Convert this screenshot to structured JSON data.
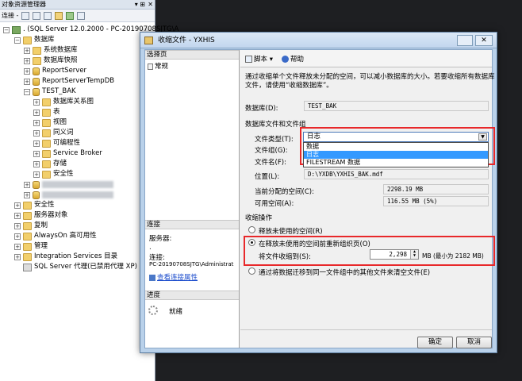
{
  "object_explorer": {
    "title": "对象资源管理器",
    "connect_label": "连接 -",
    "tree": [
      {
        "label": ". (SQL Server 12.0.2000 - PC-20190708SJTG\\A",
        "icon": "server-icon",
        "expander": "−"
      },
      {
        "label": "数据库",
        "icon": "folder-icon",
        "expander": "−"
      },
      {
        "label": "系统数据库",
        "icon": "folder-icon",
        "expander": "+"
      },
      {
        "label": "数据库快照",
        "icon": "folder-icon",
        "expander": "+"
      },
      {
        "label": "ReportServer",
        "icon": "database-icon",
        "expander": "+"
      },
      {
        "label": "ReportServerTempDB",
        "icon": "database-icon",
        "expander": "+"
      },
      {
        "label": "TEST_BAK",
        "icon": "database-icon",
        "expander": "−"
      },
      {
        "label": "数据库关系图",
        "icon": "folder-icon",
        "expander": "+"
      },
      {
        "label": "表",
        "icon": "folder-icon",
        "expander": "+"
      },
      {
        "label": "视图",
        "icon": "folder-icon",
        "expander": "+"
      },
      {
        "label": "同义词",
        "icon": "folder-icon",
        "expander": "+"
      },
      {
        "label": "可编程性",
        "icon": "folder-icon",
        "expander": "+"
      },
      {
        "label": "Service Broker",
        "icon": "folder-icon",
        "expander": "+"
      },
      {
        "label": "存储",
        "icon": "folder-icon",
        "expander": "+"
      },
      {
        "label": "安全性",
        "icon": "folder-icon",
        "expander": "+"
      },
      {
        "label": "",
        "icon": "database-icon",
        "expander": "+"
      },
      {
        "label": "",
        "icon": "database-icon",
        "expander": "+"
      },
      {
        "label": "安全性",
        "icon": "folder-icon",
        "expander": "+"
      },
      {
        "label": "服务器对象",
        "icon": "folder-icon",
        "expander": "+"
      },
      {
        "label": "复制",
        "icon": "folder-icon",
        "expander": "+"
      },
      {
        "label": "AlwaysOn 高可用性",
        "icon": "folder-icon",
        "expander": "+"
      },
      {
        "label": "管理",
        "icon": "folder-icon",
        "expander": "+"
      },
      {
        "label": "Integration Services 目录",
        "icon": "folder-icon",
        "expander": "+"
      },
      {
        "label": "SQL Server 代理(已禁用代理 XP)",
        "icon": "agent-icon",
        "expander": ""
      }
    ]
  },
  "dialog": {
    "title": "收缩文件 - YXHIS",
    "left_pane": {
      "select_page_header": "选择页",
      "page_general": "常规",
      "connection_header": "连接",
      "server_label": "服务器:",
      "server_value": ".",
      "connection_label": "连接:",
      "connection_value": "PC-20190708SJTG\\Administrat",
      "view_props_link": "查看连接属性",
      "progress_header": "进度",
      "progress_status": "就绪"
    },
    "toolbar": {
      "script_label": "脚本",
      "help_label": "帮助"
    },
    "description": "通过收缩单个文件释放未分配的空间，可以减小数据库的大小。若要收缩所有数据库文件，请使用“收缩数据库”。",
    "db_label": "数据库(D):",
    "db_value": "TEST_BAK",
    "files_section": "数据库文件和文件组",
    "file_type_label": "文件类型(T):",
    "file_type_value": "日志",
    "file_type_options": [
      "数据",
      "日志",
      "FILESTREAM 数据"
    ],
    "filegroup_label": "文件组(G):",
    "filename_label": "文件名(F):",
    "location_label": "位置(L):",
    "location_value": "D:\\YXDB\\YXHIS_BAK.mdf",
    "allocated_label": "当前分配的空间(C):",
    "allocated_value": "2298.19 MB",
    "available_label": "可用空间(A):",
    "available_value": "116.55 MB (5%)",
    "shrink_section": "收缩操作",
    "opt_release": "释放未使用的空间(R)",
    "opt_reorganize": "在释放未使用的空间前重新组织页(O)",
    "shrink_to_label": "将文件收缩到(S):",
    "shrink_to_value": "2,298",
    "shrink_unit": "MB (最小为 2182 MB)",
    "opt_empty": "通过将数据迁移到同一文件组中的其他文件来清空文件(E)",
    "ok_label": "确定",
    "cancel_label": "取消"
  },
  "colors": {
    "highlight": "#e8282a",
    "title_bar": "#c2d6ee",
    "selection": "#3399ff"
  }
}
